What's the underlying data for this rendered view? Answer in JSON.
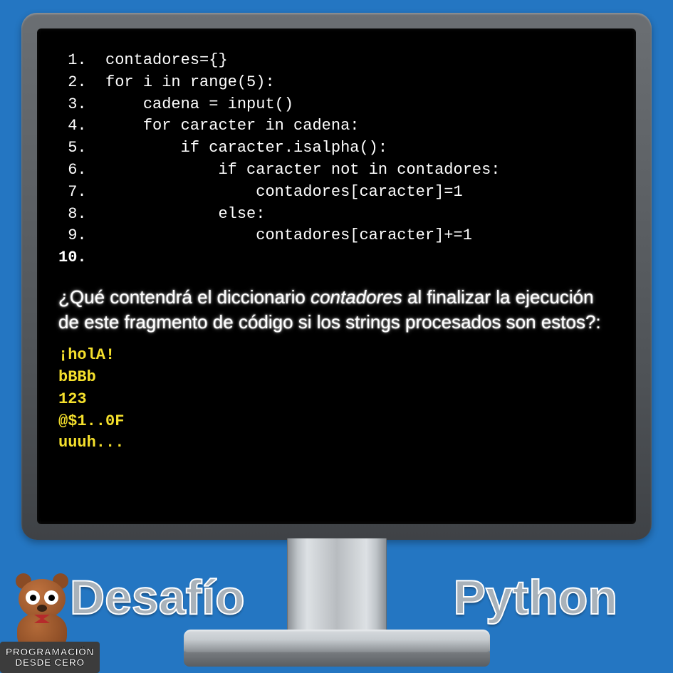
{
  "code": {
    "lines": [
      "contadores={}",
      "for i in range(5):",
      "    cadena = input()",
      "    for caracter in cadena:",
      "        if caracter.isalpha():",
      "            if caracter not in contadores:",
      "                contadores[caracter]=1",
      "            else:",
      "                contadores[caracter]+=1",
      ""
    ]
  },
  "question": {
    "part1": "¿Qué contendrá el diccionario ",
    "em": "contadores",
    "part2": " al finalizar la ejecución de este fragmento de código si los strings procesados son estos?:"
  },
  "inputs": [
    "¡holA!",
    "bBBb",
    "123",
    "@$1..0F",
    "uuuh..."
  ],
  "titles": {
    "left": "Desafío",
    "right": "Python"
  },
  "logo": {
    "line1": "PROGRAMACIÓN",
    "line2": "DESDE CERO"
  }
}
